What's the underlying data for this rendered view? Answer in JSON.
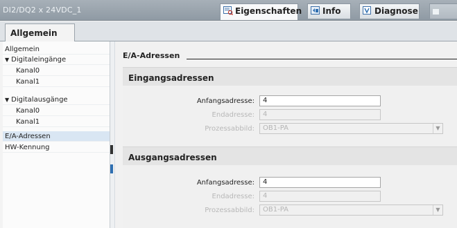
{
  "window": {
    "title": "DI2/DQ2 x 24VDC_1"
  },
  "panel_tabs": [
    {
      "label": "Eigenschaften",
      "icon": "properties-icon"
    },
    {
      "label": "Info",
      "icon": "info-icon"
    },
    {
      "label": "Diagnose",
      "icon": "diagnose-icon"
    }
  ],
  "main_tab": {
    "label": "Allgemein"
  },
  "nav": [
    {
      "label": "Allgemein"
    },
    {
      "label": "Digitaleingänge"
    },
    {
      "label": "Kanal0"
    },
    {
      "label": "Kanal1"
    },
    {
      "label": "Digitalausgänge"
    },
    {
      "label": "Kanal0"
    },
    {
      "label": "Kanal1"
    },
    {
      "label": "E/A-Adressen"
    },
    {
      "label": "HW-Kennung"
    }
  ],
  "section": {
    "title": "E/A-Adressen"
  },
  "input_addresses": {
    "title": "Eingangsadressen",
    "start_label": "Anfangsadresse:",
    "start_value": "4",
    "end_label": "Endadresse:",
    "end_value": "4",
    "image_label": "Prozessabbild:",
    "image_value": "OB1-PA"
  },
  "output_addresses": {
    "title": "Ausgangsadressen",
    "start_label": "Anfangsadresse:",
    "start_value": "4",
    "end_label": "Endadresse:",
    "end_value": "4",
    "image_label": "Prozessabbild:",
    "image_value": "OB1-PA"
  },
  "colors": {
    "title_bar": "#9aa5ae",
    "selection": "#d9e6f3",
    "accent": "#2f6fb1"
  }
}
